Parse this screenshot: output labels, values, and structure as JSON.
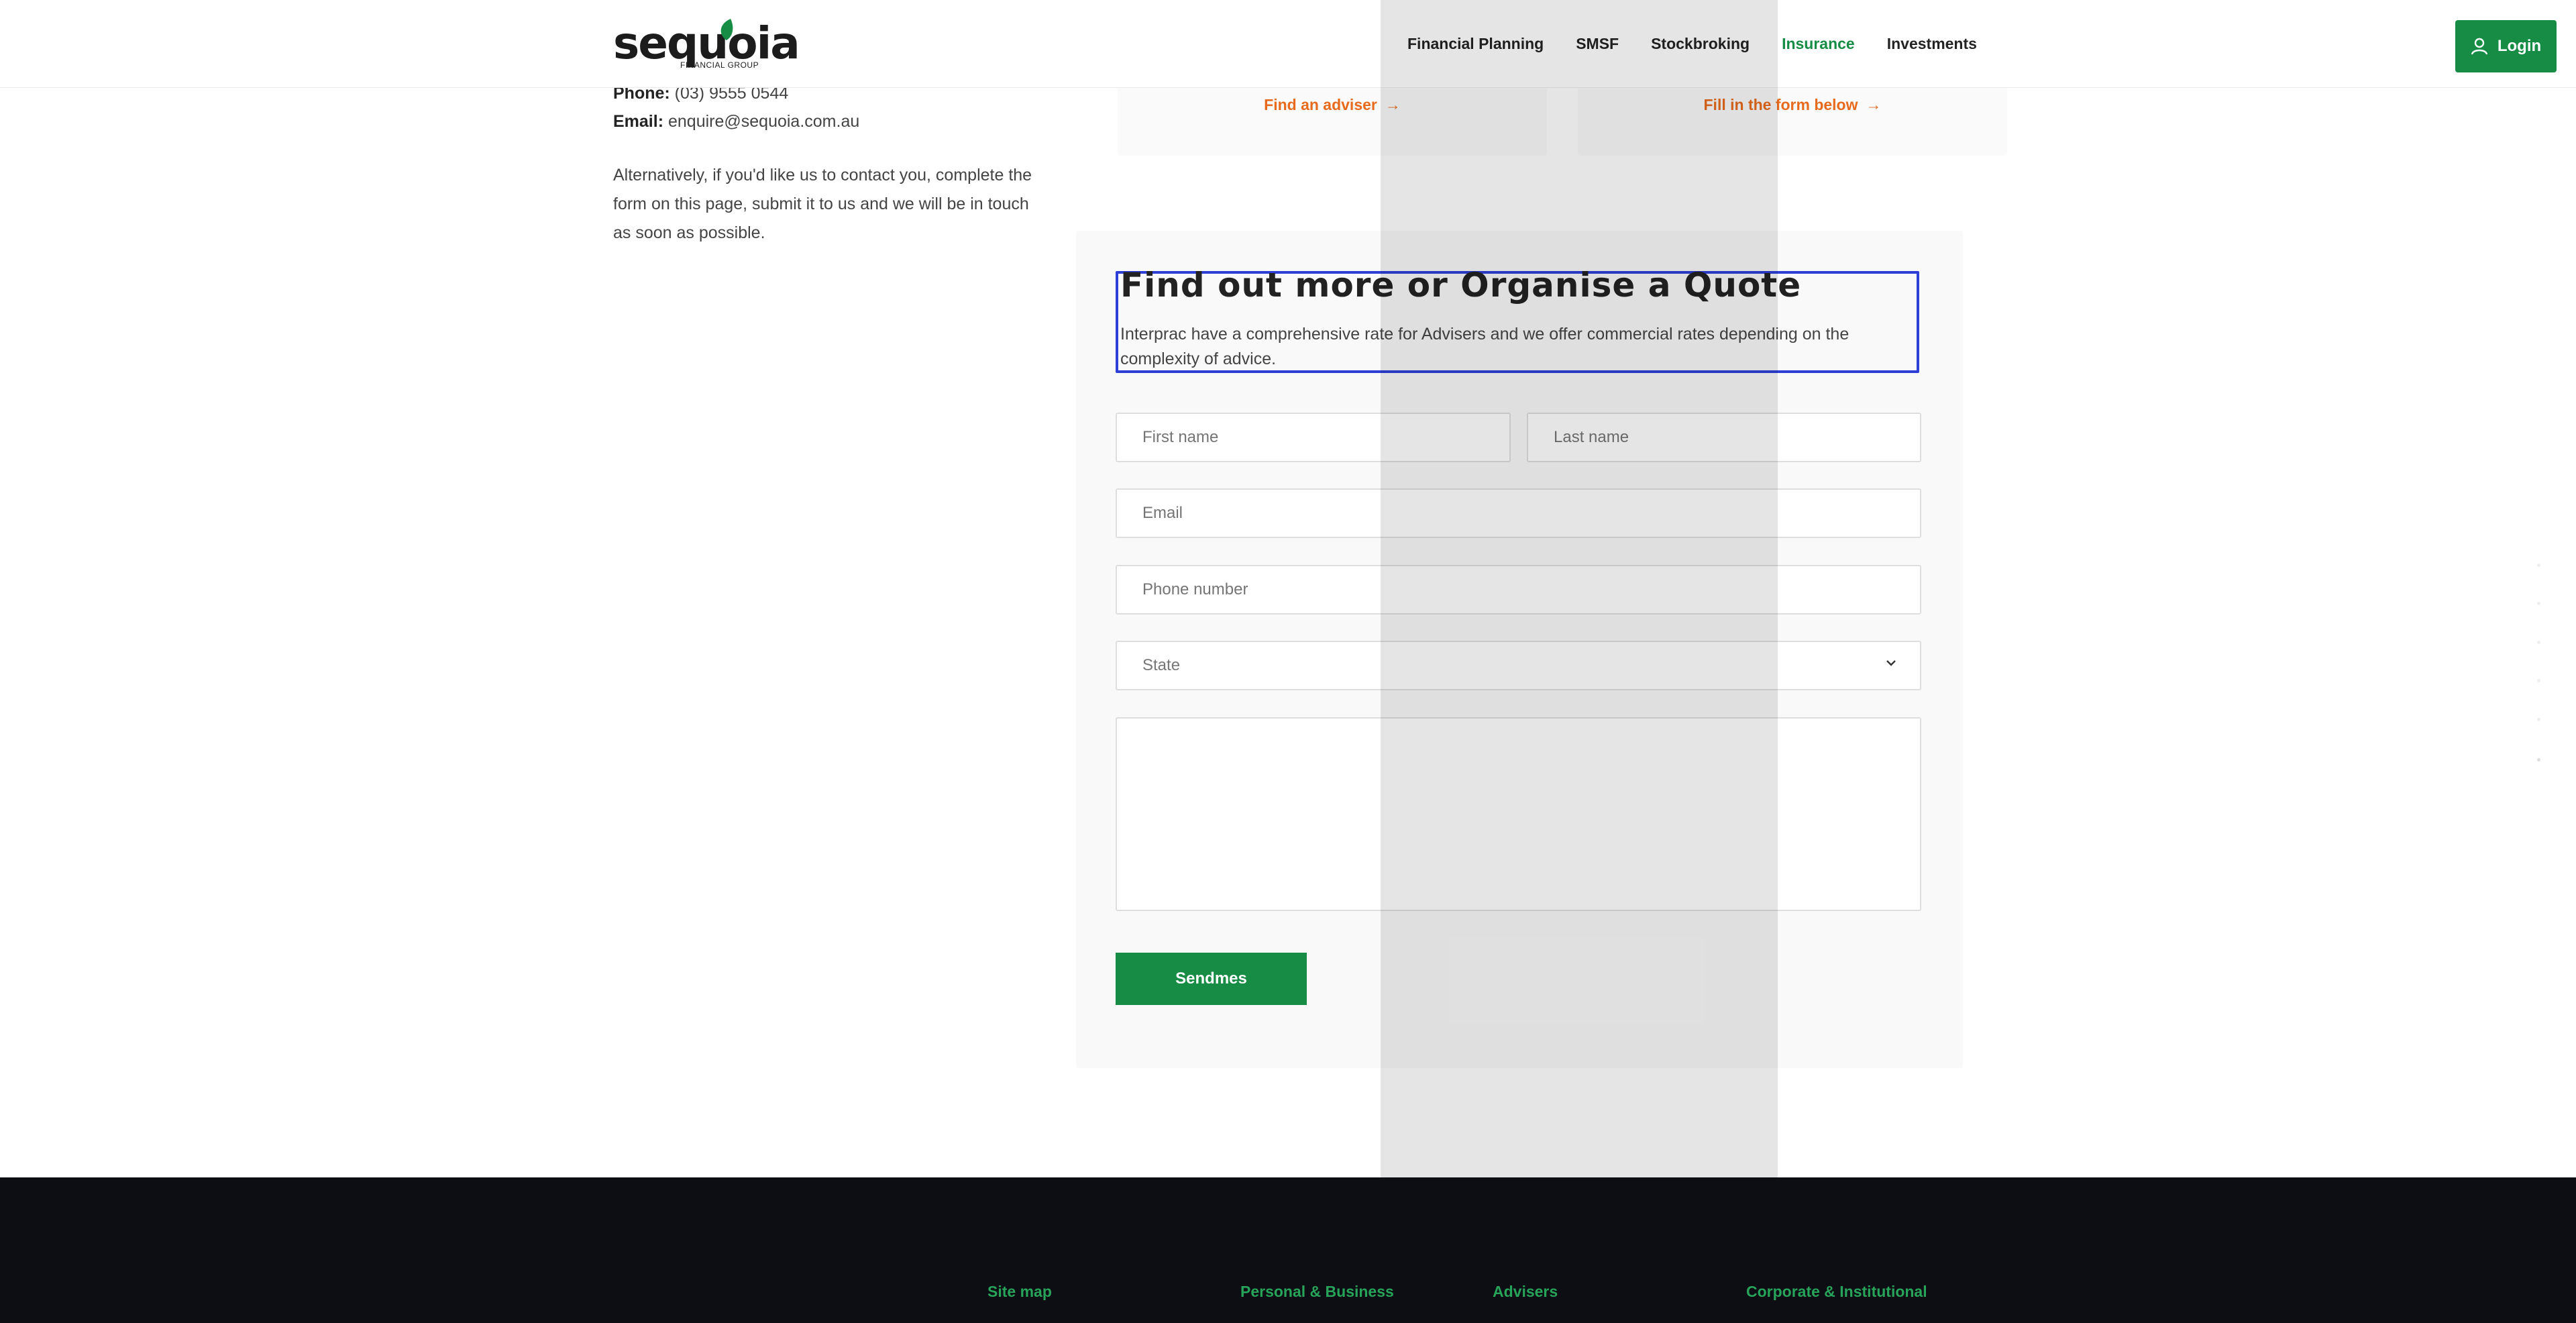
{
  "header": {
    "logo_text": "sequoia",
    "logo_subtext": "FINANCIAL GROUP",
    "nav": [
      {
        "label": "Financial Planning",
        "active": false
      },
      {
        "label": "SMSF",
        "active": false
      },
      {
        "label": "Stockbroking",
        "active": false
      },
      {
        "label": "Insurance",
        "active": true
      },
      {
        "label": "Investments",
        "active": false
      }
    ],
    "login_label": "Login"
  },
  "contact": {
    "phone_label": "Phone:",
    "phone_value": "(03) 9555 0544",
    "email_label": "Email:",
    "email_value": "enquire@sequoia.com.au",
    "paragraph": "Alternatively, if you'd like us to contact you, complete the form on this page, submit it to us and we will be in touch as soon as possible."
  },
  "cards": [
    {
      "link": "Find an adviser"
    },
    {
      "link": "Fill in the form below"
    }
  ],
  "form": {
    "title": "Find out more or Organise a Quote",
    "description": "Interprac have a comprehensive rate for Advisers and we offer commercial rates depending on the complexity of advice.",
    "first_name_placeholder": "First name",
    "last_name_placeholder": "Last name",
    "email_placeholder": "Email",
    "phone_placeholder": "Phone number",
    "state_placeholder": "State",
    "submit_label": "Sendmes"
  },
  "footer": {
    "columns": [
      "Site map",
      "Personal & Business",
      "Advisers",
      "Corporate & Institutional"
    ]
  },
  "colors": {
    "brand_green": "#168c45",
    "accent_orange": "#e86a1c",
    "focus_blue": "#2d3fd6",
    "footer_bg": "#0c0e13"
  }
}
